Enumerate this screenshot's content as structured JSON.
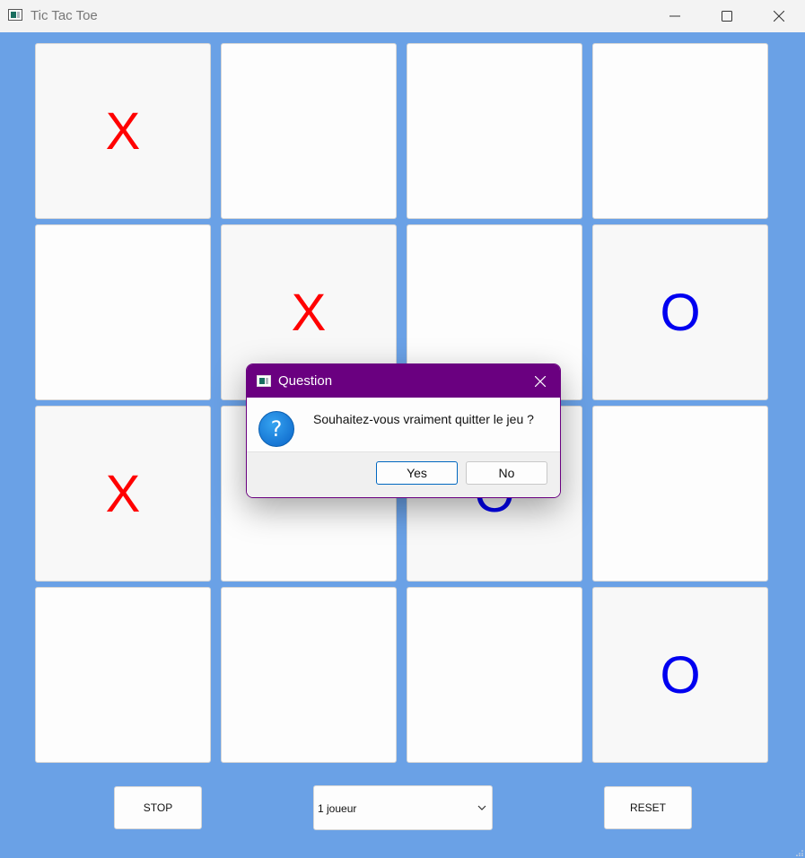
{
  "window": {
    "title": "Tic Tac Toe"
  },
  "board": {
    "rows": [
      [
        {
          "mark": "X"
        },
        {
          "mark": ""
        },
        {
          "mark": ""
        },
        {
          "mark": ""
        }
      ],
      [
        {
          "mark": ""
        },
        {
          "mark": "X"
        },
        {
          "mark": ""
        },
        {
          "mark": "O"
        }
      ],
      [
        {
          "mark": "X"
        },
        {
          "mark": ""
        },
        {
          "mark": "O"
        },
        {
          "mark": ""
        }
      ],
      [
        {
          "mark": ""
        },
        {
          "mark": ""
        },
        {
          "mark": ""
        },
        {
          "mark": "O"
        }
      ]
    ]
  },
  "controls": {
    "stop_label": "STOP",
    "mode_select": {
      "value": "1 joueur"
    },
    "reset_label": "RESET"
  },
  "dialog": {
    "title": "Question",
    "message": "Souhaitez-vous vraiment quitter le jeu ?",
    "icon": "question-icon",
    "yes_label": "Yes",
    "no_label": "No"
  },
  "colors": {
    "background": "#6aa1e6",
    "x_mark": "#ff0000",
    "o_mark": "#0000f0",
    "dialog_titlebar": "#6a0080"
  }
}
